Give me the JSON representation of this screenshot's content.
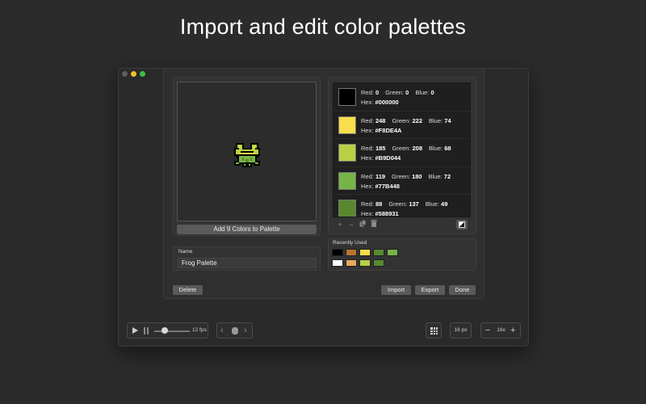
{
  "headline": "Import and edit color palettes",
  "preview": {
    "add_button_label": "Add 9 Colors to Palette"
  },
  "name_field": {
    "label": "Name",
    "value": "Frog Palette"
  },
  "palette": {
    "labels": {
      "red": "Red:",
      "green": "Green:",
      "blue": "Blue:",
      "hex": "Hex:"
    },
    "colors": [
      {
        "red": "0",
        "green": "0",
        "blue": "0",
        "hex": "#000000",
        "swatch": "#000000"
      },
      {
        "red": "248",
        "green": "222",
        "blue": "74",
        "hex": "#F8DE4A",
        "swatch": "#F8DE4A"
      },
      {
        "red": "185",
        "green": "208",
        "blue": "68",
        "hex": "#B9D044",
        "swatch": "#B9D044"
      },
      {
        "red": "119",
        "green": "180",
        "blue": "72",
        "hex": "#77B448",
        "swatch": "#77B448"
      },
      {
        "red": "88",
        "green": "137",
        "blue": "49",
        "hex": "#588931",
        "swatch": "#588931"
      }
    ],
    "tools": {
      "add_icon": "plus-icon",
      "remove_icon": "minus-icon",
      "duplicate_icon": "duplicate-icon",
      "trash_icon": "trash-icon",
      "contrast_icon": "contrast-icon"
    }
  },
  "recently_used": {
    "label": "Recently Used",
    "row1": [
      "#000000",
      "#B8762E",
      "#F8DE4A",
      "#588931",
      "#77B448"
    ],
    "row2": [
      "#FFFFFF",
      "#E8A95A",
      "#B9D044",
      "#588931"
    ]
  },
  "sheet_buttons": {
    "delete": "Delete",
    "import": "Import",
    "export": "Export",
    "done": "Done"
  },
  "toolbar": {
    "fps": "12 fps",
    "playback_position": 0.25,
    "pixel_size": "16 px",
    "zoom": "16x"
  },
  "colors": {
    "background": "#2b2b2b",
    "window": "#2a2a2a",
    "traffic_close": "#5d5d5d",
    "traffic_min": "#f2c02c",
    "traffic_max": "#3ebc4a"
  }
}
